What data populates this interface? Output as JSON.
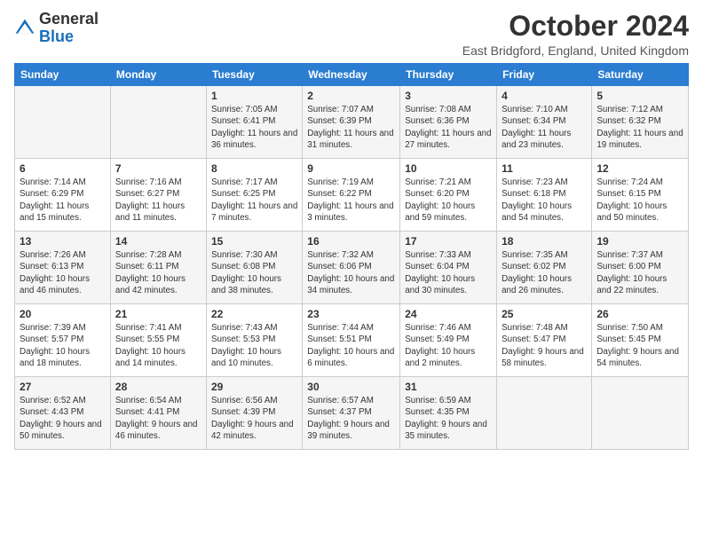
{
  "header": {
    "logo_general": "General",
    "logo_blue": "Blue",
    "month_title": "October 2024",
    "location": "East Bridgford, England, United Kingdom"
  },
  "days_of_week": [
    "Sunday",
    "Monday",
    "Tuesday",
    "Wednesday",
    "Thursday",
    "Friday",
    "Saturday"
  ],
  "weeks": [
    [
      {
        "day": "",
        "detail": ""
      },
      {
        "day": "",
        "detail": ""
      },
      {
        "day": "1",
        "detail": "Sunrise: 7:05 AM\nSunset: 6:41 PM\nDaylight: 11 hours and 36 minutes."
      },
      {
        "day": "2",
        "detail": "Sunrise: 7:07 AM\nSunset: 6:39 PM\nDaylight: 11 hours and 31 minutes."
      },
      {
        "day": "3",
        "detail": "Sunrise: 7:08 AM\nSunset: 6:36 PM\nDaylight: 11 hours and 27 minutes."
      },
      {
        "day": "4",
        "detail": "Sunrise: 7:10 AM\nSunset: 6:34 PM\nDaylight: 11 hours and 23 minutes."
      },
      {
        "day": "5",
        "detail": "Sunrise: 7:12 AM\nSunset: 6:32 PM\nDaylight: 11 hours and 19 minutes."
      }
    ],
    [
      {
        "day": "6",
        "detail": "Sunrise: 7:14 AM\nSunset: 6:29 PM\nDaylight: 11 hours and 15 minutes."
      },
      {
        "day": "7",
        "detail": "Sunrise: 7:16 AM\nSunset: 6:27 PM\nDaylight: 11 hours and 11 minutes."
      },
      {
        "day": "8",
        "detail": "Sunrise: 7:17 AM\nSunset: 6:25 PM\nDaylight: 11 hours and 7 minutes."
      },
      {
        "day": "9",
        "detail": "Sunrise: 7:19 AM\nSunset: 6:22 PM\nDaylight: 11 hours and 3 minutes."
      },
      {
        "day": "10",
        "detail": "Sunrise: 7:21 AM\nSunset: 6:20 PM\nDaylight: 10 hours and 59 minutes."
      },
      {
        "day": "11",
        "detail": "Sunrise: 7:23 AM\nSunset: 6:18 PM\nDaylight: 10 hours and 54 minutes."
      },
      {
        "day": "12",
        "detail": "Sunrise: 7:24 AM\nSunset: 6:15 PM\nDaylight: 10 hours and 50 minutes."
      }
    ],
    [
      {
        "day": "13",
        "detail": "Sunrise: 7:26 AM\nSunset: 6:13 PM\nDaylight: 10 hours and 46 minutes."
      },
      {
        "day": "14",
        "detail": "Sunrise: 7:28 AM\nSunset: 6:11 PM\nDaylight: 10 hours and 42 minutes."
      },
      {
        "day": "15",
        "detail": "Sunrise: 7:30 AM\nSunset: 6:08 PM\nDaylight: 10 hours and 38 minutes."
      },
      {
        "day": "16",
        "detail": "Sunrise: 7:32 AM\nSunset: 6:06 PM\nDaylight: 10 hours and 34 minutes."
      },
      {
        "day": "17",
        "detail": "Sunrise: 7:33 AM\nSunset: 6:04 PM\nDaylight: 10 hours and 30 minutes."
      },
      {
        "day": "18",
        "detail": "Sunrise: 7:35 AM\nSunset: 6:02 PM\nDaylight: 10 hours and 26 minutes."
      },
      {
        "day": "19",
        "detail": "Sunrise: 7:37 AM\nSunset: 6:00 PM\nDaylight: 10 hours and 22 minutes."
      }
    ],
    [
      {
        "day": "20",
        "detail": "Sunrise: 7:39 AM\nSunset: 5:57 PM\nDaylight: 10 hours and 18 minutes."
      },
      {
        "day": "21",
        "detail": "Sunrise: 7:41 AM\nSunset: 5:55 PM\nDaylight: 10 hours and 14 minutes."
      },
      {
        "day": "22",
        "detail": "Sunrise: 7:43 AM\nSunset: 5:53 PM\nDaylight: 10 hours and 10 minutes."
      },
      {
        "day": "23",
        "detail": "Sunrise: 7:44 AM\nSunset: 5:51 PM\nDaylight: 10 hours and 6 minutes."
      },
      {
        "day": "24",
        "detail": "Sunrise: 7:46 AM\nSunset: 5:49 PM\nDaylight: 10 hours and 2 minutes."
      },
      {
        "day": "25",
        "detail": "Sunrise: 7:48 AM\nSunset: 5:47 PM\nDaylight: 9 hours and 58 minutes."
      },
      {
        "day": "26",
        "detail": "Sunrise: 7:50 AM\nSunset: 5:45 PM\nDaylight: 9 hours and 54 minutes."
      }
    ],
    [
      {
        "day": "27",
        "detail": "Sunrise: 6:52 AM\nSunset: 4:43 PM\nDaylight: 9 hours and 50 minutes."
      },
      {
        "day": "28",
        "detail": "Sunrise: 6:54 AM\nSunset: 4:41 PM\nDaylight: 9 hours and 46 minutes."
      },
      {
        "day": "29",
        "detail": "Sunrise: 6:56 AM\nSunset: 4:39 PM\nDaylight: 9 hours and 42 minutes."
      },
      {
        "day": "30",
        "detail": "Sunrise: 6:57 AM\nSunset: 4:37 PM\nDaylight: 9 hours and 39 minutes."
      },
      {
        "day": "31",
        "detail": "Sunrise: 6:59 AM\nSunset: 4:35 PM\nDaylight: 9 hours and 35 minutes."
      },
      {
        "day": "",
        "detail": ""
      },
      {
        "day": "",
        "detail": ""
      }
    ]
  ]
}
